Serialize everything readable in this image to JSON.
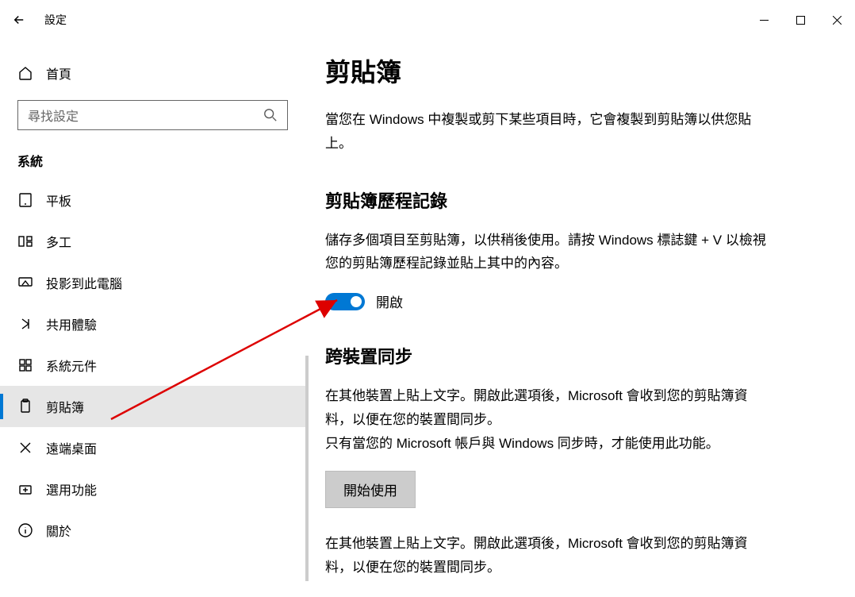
{
  "titlebar": {
    "app_title": "設定"
  },
  "sidebar": {
    "home_label": "首頁",
    "search_placeholder": "尋找設定",
    "section_label": "系統",
    "items": [
      {
        "label": "平板",
        "icon": "tablet-icon"
      },
      {
        "label": "多工",
        "icon": "multitask-icon"
      },
      {
        "label": "投影到此電腦",
        "icon": "project-icon"
      },
      {
        "label": "共用體驗",
        "icon": "shared-icon"
      },
      {
        "label": "系統元件",
        "icon": "components-icon"
      },
      {
        "label": "剪貼簿",
        "icon": "clipboard-icon"
      },
      {
        "label": "遠端桌面",
        "icon": "remote-icon"
      },
      {
        "label": "選用功能",
        "icon": "optional-icon"
      },
      {
        "label": "關於",
        "icon": "about-icon"
      }
    ]
  },
  "content": {
    "page_title": "剪貼簿",
    "intro": "當您在 Windows 中複製或剪下某些項目時，它會複製到剪貼簿以供您貼上。",
    "history_title": "剪貼簿歷程記錄",
    "history_desc": "儲存多個項目至剪貼簿，以供稍後使用。請按 Windows 標誌鍵 + V 以檢視您的剪貼簿歷程記錄並貼上其中的內容。",
    "toggle_label": "開啟",
    "sync_title": "跨裝置同步",
    "sync_desc1": "在其他裝置上貼上文字。開啟此選項後，Microsoft 會收到您的剪貼簿資料，以便在您的裝置間同步。",
    "sync_desc2": "只有當您的 Microsoft 帳戶與 Windows 同步時，才能使用此功能。",
    "sync_button": "開始使用",
    "sync_desc3a": "在其他裝置上貼上文字。開啟此選項後，Microsoft 會收到您的剪貼簿資料，以便在您的裝置間同步。"
  }
}
